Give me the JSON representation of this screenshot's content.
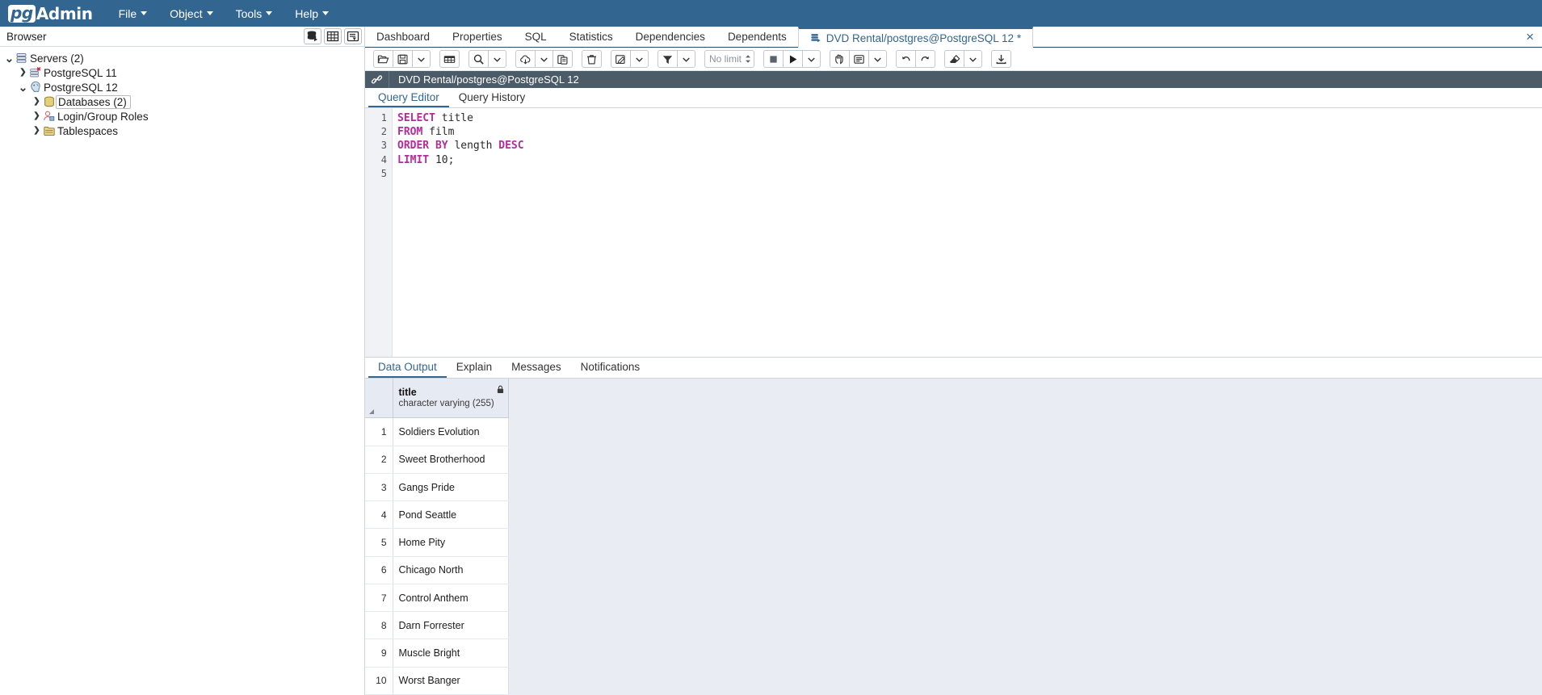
{
  "header": {
    "logo_pg": "pg",
    "logo_admin": "Admin",
    "menus": [
      {
        "label": "File",
        "name": "menu-file"
      },
      {
        "label": "Object",
        "name": "menu-object"
      },
      {
        "label": "Tools",
        "name": "menu-tools"
      },
      {
        "label": "Help",
        "name": "menu-help"
      }
    ],
    "brand_color": "#326690"
  },
  "sidebar": {
    "title": "Browser",
    "buttons": [
      {
        "name": "add-server-button",
        "icon": "server-add-icon"
      },
      {
        "name": "grid-view-button",
        "icon": "grid-icon"
      },
      {
        "name": "filter-tree-button",
        "icon": "tree-filter-icon"
      }
    ],
    "tree": [
      {
        "label": "Servers (2)",
        "indent": 0,
        "expanded": true,
        "icon": "servers-icon",
        "selected": false
      },
      {
        "label": "PostgreSQL 11",
        "indent": 1,
        "expanded": false,
        "icon": "server-disconnected-icon",
        "selected": false
      },
      {
        "label": "PostgreSQL 12",
        "indent": 1,
        "expanded": true,
        "icon": "postgresql-elephant-icon",
        "selected": false
      },
      {
        "label": "Databases (2)",
        "indent": 2,
        "expanded": false,
        "icon": "databases-coins-icon",
        "selected": true
      },
      {
        "label": "Login/Group Roles",
        "indent": 2,
        "expanded": false,
        "icon": "roles-icon",
        "selected": false
      },
      {
        "label": "Tablespaces",
        "indent": 2,
        "expanded": false,
        "icon": "tablespaces-icon",
        "selected": false
      }
    ]
  },
  "object_tabs": {
    "items": [
      {
        "label": "Dashboard",
        "name": "tab-dashboard",
        "active": false
      },
      {
        "label": "Properties",
        "name": "tab-properties",
        "active": false
      },
      {
        "label": "SQL",
        "name": "tab-sql",
        "active": false
      },
      {
        "label": "Statistics",
        "name": "tab-statistics",
        "active": false
      },
      {
        "label": "Dependencies",
        "name": "tab-dependencies",
        "active": false
      },
      {
        "label": "Dependents",
        "name": "tab-dependents",
        "active": false
      },
      {
        "label": "DVD Rental/postgres@PostgreSQL 12 *",
        "name": "tab-query-tool",
        "active": true
      }
    ],
    "close_label": "×"
  },
  "query_toolbar": {
    "groups": [
      {
        "name": "file-group",
        "buttons": [
          {
            "name": "open-file-button",
            "icon": "folder-open-icon",
            "disabled": false
          },
          {
            "name": "save-file-button",
            "icon": "floppy-save-icon",
            "disabled": false
          },
          {
            "name": "save-options-button",
            "icon": "chevron-down-icon",
            "caret": true,
            "disabled": false
          }
        ]
      },
      {
        "name": "edit-group",
        "buttons": [
          {
            "name": "edit-grid-button",
            "icon": "data-grid-icon",
            "disabled": false
          }
        ]
      },
      {
        "name": "find-group",
        "buttons": [
          {
            "name": "find-button",
            "icon": "magnifier-icon",
            "disabled": false
          },
          {
            "name": "find-options-button",
            "icon": "chevron-down-icon",
            "caret": true,
            "disabled": false
          }
        ]
      },
      {
        "name": "copy-group",
        "buttons": [
          {
            "name": "copy-button",
            "icon": "copy-icon",
            "disabled": false
          },
          {
            "name": "copy-options-button",
            "icon": "chevron-down-icon",
            "caret": true,
            "disabled": false
          },
          {
            "name": "paste-button",
            "icon": "paste-icon",
            "disabled": false
          }
        ]
      },
      {
        "name": "delete-group",
        "buttons": [
          {
            "name": "delete-row-button",
            "icon": "trash-icon",
            "disabled": false
          }
        ]
      },
      {
        "name": "save-data-group",
        "buttons": [
          {
            "name": "save-data-changes-button",
            "icon": "pencil-save-icon",
            "disabled": false
          },
          {
            "name": "save-data-options-button",
            "icon": "chevron-down-icon",
            "caret": true,
            "disabled": false
          }
        ]
      },
      {
        "name": "filter-group",
        "buttons": [
          {
            "name": "filter-button",
            "icon": "funnel-icon",
            "disabled": false
          },
          {
            "name": "filter-options-button",
            "icon": "chevron-down-icon",
            "caret": true,
            "disabled": false
          }
        ]
      }
    ],
    "row_limit": {
      "name": "row-limit-input",
      "value": "No limit"
    },
    "exec_group": [
      {
        "name": "stop-query-button",
        "icon": "stop-square-icon",
        "disabled": false
      },
      {
        "name": "execute-query-button",
        "icon": "play-triangle-icon",
        "disabled": false
      },
      {
        "name": "execute-options-button",
        "icon": "chevron-down-icon",
        "caret": true,
        "disabled": false
      }
    ],
    "explain_group": [
      {
        "name": "explain-button",
        "icon": "explain-hand-icon",
        "disabled": false
      },
      {
        "name": "explain-analyze-button",
        "icon": "explain-analyze-icon",
        "disabled": false
      },
      {
        "name": "explain-options-button",
        "icon": "chevron-down-icon",
        "caret": true,
        "disabled": false
      }
    ],
    "history_group": [
      {
        "name": "undo-button",
        "icon": "undo-arrow-icon",
        "disabled": false
      },
      {
        "name": "redo-button",
        "icon": "redo-arrow-icon",
        "disabled": false
      }
    ],
    "clear_group": [
      {
        "name": "clear-button",
        "icon": "eraser-icon",
        "disabled": false
      },
      {
        "name": "clear-options-button",
        "icon": "chevron-down-icon",
        "caret": true,
        "disabled": false
      }
    ],
    "download_group": [
      {
        "name": "download-csv-button",
        "icon": "download-icon",
        "disabled": false
      }
    ]
  },
  "connection_bar": {
    "icon": "chain-link-icon",
    "text": "DVD Rental/postgres@PostgreSQL 12"
  },
  "editor_tabs": [
    {
      "label": "Query Editor",
      "name": "tab-query-editor",
      "active": true
    },
    {
      "label": "Query History",
      "name": "tab-query-history",
      "active": false
    }
  ],
  "editor": {
    "line_numbers": [
      "1",
      "2",
      "3",
      "4",
      "5"
    ],
    "lines": [
      [
        {
          "t": "SELECT",
          "c": "kw"
        },
        {
          "t": " title",
          "c": "id"
        }
      ],
      [
        {
          "t": "FROM",
          "c": "kw"
        },
        {
          "t": " film",
          "c": "id"
        }
      ],
      [
        {
          "t": "ORDER BY",
          "c": "kw"
        },
        {
          "t": " length ",
          "c": "id"
        },
        {
          "t": "DESC",
          "c": "kw"
        }
      ],
      [
        {
          "t": "LIMIT",
          "c": "kw"
        },
        {
          "t": " ",
          "c": "id"
        },
        {
          "t": "10",
          "c": "num"
        },
        {
          "t": ";",
          "c": "id"
        }
      ],
      []
    ],
    "plain_sql": "SELECT title\nFROM film\nORDER BY length DESC\nLIMIT 10;"
  },
  "output_tabs": [
    {
      "label": "Data Output",
      "name": "tab-data-output",
      "active": true
    },
    {
      "label": "Explain",
      "name": "tab-explain",
      "active": false
    },
    {
      "label": "Messages",
      "name": "tab-messages",
      "active": false
    },
    {
      "label": "Notifications",
      "name": "tab-notifications",
      "active": false
    }
  ],
  "grid": {
    "column": {
      "name": "title",
      "type": "character varying (255)",
      "lock_icon": "lock-icon"
    },
    "rows": [
      {
        "num": "1",
        "title": "Soldiers Evolution"
      },
      {
        "num": "2",
        "title": "Sweet Brotherhood"
      },
      {
        "num": "3",
        "title": "Gangs Pride"
      },
      {
        "num": "4",
        "title": "Pond Seattle"
      },
      {
        "num": "5",
        "title": "Home Pity"
      },
      {
        "num": "6",
        "title": "Chicago North"
      },
      {
        "num": "7",
        "title": "Control Anthem"
      },
      {
        "num": "8",
        "title": "Darn Forrester"
      },
      {
        "num": "9",
        "title": "Muscle Bright"
      },
      {
        "num": "10",
        "title": "Worst Banger"
      }
    ]
  }
}
